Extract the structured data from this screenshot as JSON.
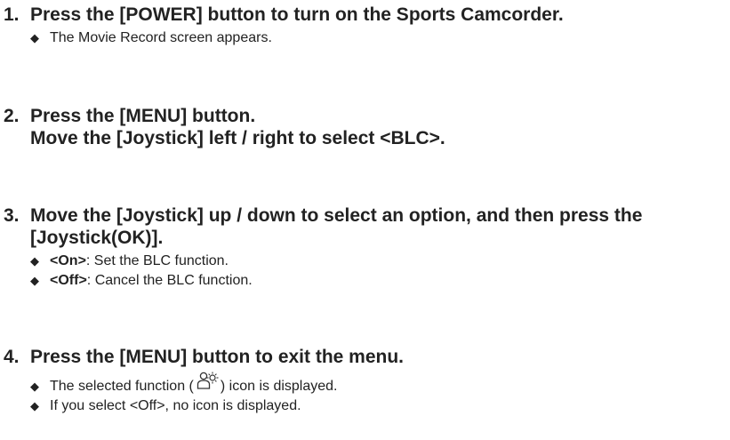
{
  "steps": [
    {
      "number": "1.",
      "heading": [
        "Press the [POWER] button to turn on the Sports Camcorder."
      ],
      "bullets": [
        {
          "term": "",
          "text": "The Movie Record screen appears."
        }
      ]
    },
    {
      "number": "2.",
      "heading": [
        "Press the [MENU] button.",
        "Move the [Joystick] left / right to select <BLC>."
      ],
      "bullets": []
    },
    {
      "number": "3.",
      "heading": [
        "Move the [Joystick] up / down to select an option, and then press the",
        "[Joystick(OK)]."
      ],
      "bullets": [
        {
          "term": "<On>",
          "text": ": Set the BLC function."
        },
        {
          "term": "<Off>",
          "text": ": Cancel the BLC function."
        }
      ]
    },
    {
      "number": "4.",
      "heading": [
        "Press the [MENU] button to exit the menu."
      ],
      "bullets": [
        {
          "before": "The selected function (",
          "icon": "blc-icon",
          "after": ") icon is displayed."
        },
        {
          "term": "",
          "text": "If you select <Off>, no icon is displayed."
        }
      ]
    }
  ],
  "bullet_symbol": "◆"
}
